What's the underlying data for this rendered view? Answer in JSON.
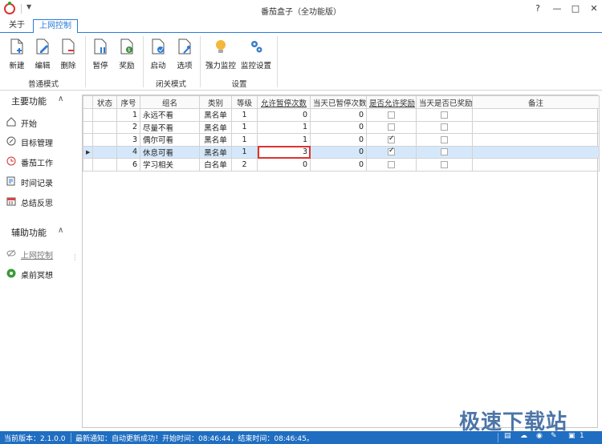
{
  "window": {
    "title": "番茄盒子（全功能版）",
    "help": "?",
    "minimize": "—",
    "maximize": "□",
    "close": "✕"
  },
  "menu": {
    "tabs": [
      "关于",
      "上网控制"
    ]
  },
  "ribbon": {
    "buttons": [
      "新建",
      "编辑",
      "删除",
      "暂停",
      "奖励",
      "启动",
      "选项",
      "强力监控",
      "监控设置"
    ],
    "groups": [
      "普通模式",
      "闭关模式",
      "设置"
    ]
  },
  "sidebar": {
    "main_title": "主要功能",
    "main_items": [
      "开始",
      "目标管理",
      "番茄工作",
      "时间记录",
      "总结反思"
    ],
    "aux_title": "辅助功能",
    "aux_items": [
      "上网控制",
      "桌前冥想"
    ]
  },
  "table": {
    "headers": [
      "状态",
      "序号",
      "组名",
      "类别",
      "等级",
      "允许暂停次数",
      "当天已暂停次数",
      "是否允许奖励",
      "当天是否已奖励",
      "备注"
    ],
    "rows": [
      {
        "seq": "1",
        "name": "永远不看",
        "type": "黑名单",
        "level": "1",
        "allowed": "0",
        "paused": "0",
        "allow_reward": false,
        "rewarded": false,
        "note": ""
      },
      {
        "seq": "2",
        "name": "尽量不看",
        "type": "黑名单",
        "level": "1",
        "allowed": "1",
        "paused": "0",
        "allow_reward": false,
        "rewarded": false,
        "note": ""
      },
      {
        "seq": "3",
        "name": "偶尔可看",
        "type": "黑名单",
        "level": "1",
        "allowed": "1",
        "paused": "0",
        "allow_reward": true,
        "rewarded": false,
        "note": ""
      },
      {
        "seq": "4",
        "name": "休息可看",
        "type": "黑名单",
        "level": "1",
        "allowed": "3",
        "paused": "0",
        "allow_reward": true,
        "rewarded": false,
        "note": ""
      },
      {
        "seq": "6",
        "name": "学习相关",
        "type": "白名单",
        "level": "2",
        "allowed": "0",
        "paused": "0",
        "allow_reward": false,
        "rewarded": false,
        "note": ""
      }
    ]
  },
  "status": {
    "version": "当前版本：2.1.0.0",
    "notice": "最新通知：自动更新成功！开始时间：08:46:44，结束时间：08:46:45。",
    "tray_count": "1"
  },
  "watermark": "极速下载站",
  "colors": {
    "accent": "#2a7bd8",
    "statusbar": "#1f6ec1",
    "selected_row": "#d5e8fb",
    "edit_outline": "#dd3333"
  }
}
